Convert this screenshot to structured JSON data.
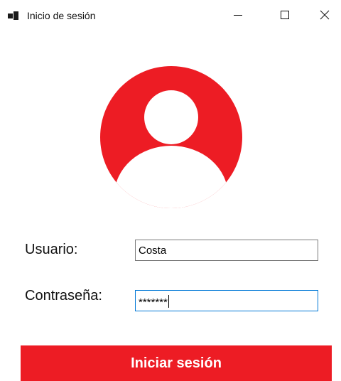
{
  "window": {
    "title": "Inicio de sesión",
    "icon": "winforms-app-icon",
    "controls": [
      "minimize-icon",
      "maximize-icon",
      "close-icon"
    ]
  },
  "avatar": {
    "icon": "user-avatar-icon",
    "color": "#ed1c24"
  },
  "form": {
    "user_label": "Usuario:",
    "user_value": "Costa",
    "password_label": "Contraseña:",
    "password_value": "*******"
  },
  "login_button": {
    "label": "Iniciar sesión",
    "color": "#ed1c24"
  }
}
